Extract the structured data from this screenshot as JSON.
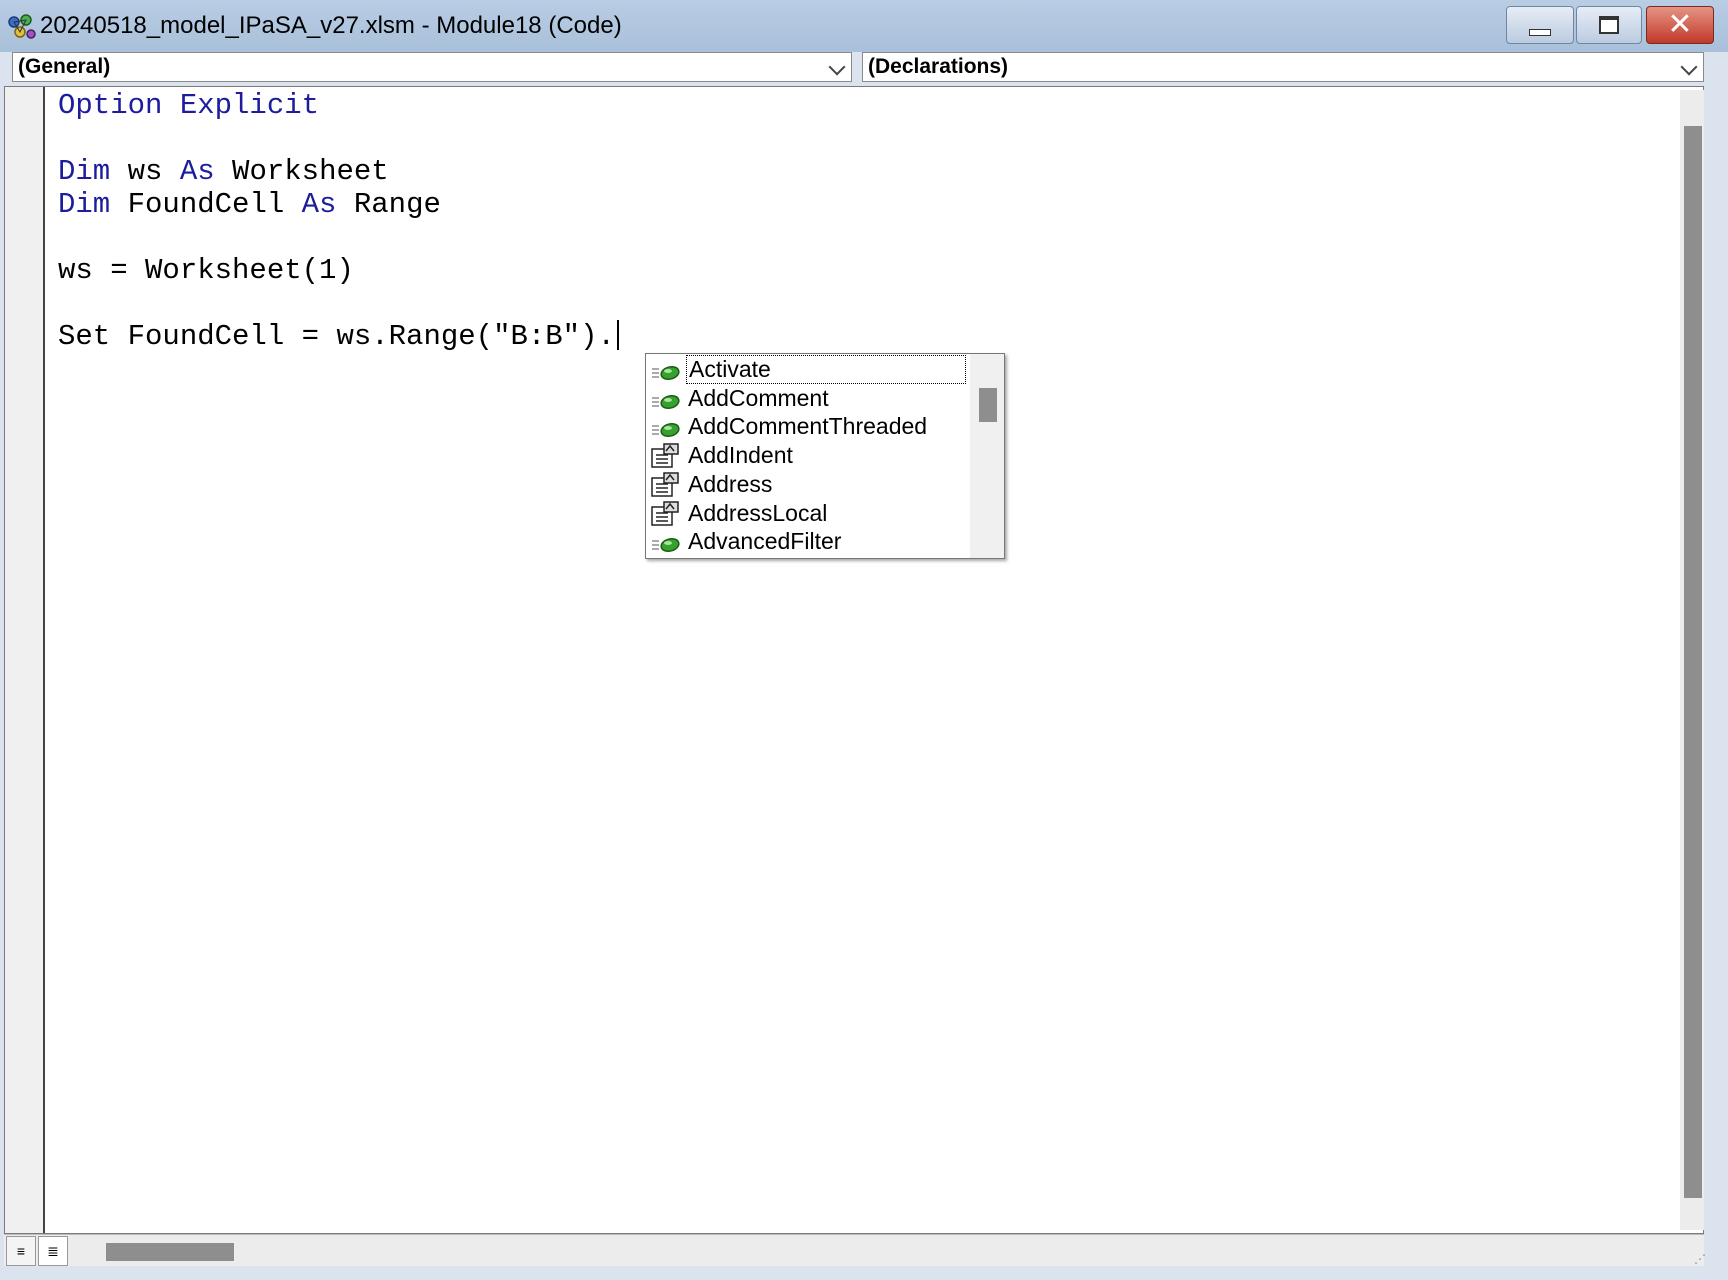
{
  "window": {
    "title": "20240518_model_IPaSA_v27.xlsm - Module18 (Code)"
  },
  "combos": {
    "object_value": "(General)",
    "procedure_value": "(Declarations)"
  },
  "code": {
    "lines": [
      [
        {
          "t": "Option Explicit",
          "k": true
        }
      ],
      [],
      [
        {
          "t": "Dim",
          "k": true
        },
        {
          "t": " ws ",
          "k": false
        },
        {
          "t": "As",
          "k": true
        },
        {
          "t": " Worksheet",
          "k": false
        }
      ],
      [
        {
          "t": "Dim",
          "k": true
        },
        {
          "t": " FoundCell ",
          "k": false
        },
        {
          "t": "As",
          "k": true
        },
        {
          "t": " Range",
          "k": false
        }
      ],
      [],
      [
        {
          "t": "ws = Worksheet(1)",
          "k": false
        }
      ],
      [],
      [
        {
          "t": "Set FoundCell = ws.Range(\"B:B\").",
          "k": false
        }
      ]
    ],
    "keyword_color": "#1c1c9c"
  },
  "intellisense": {
    "items": [
      {
        "label": "Activate",
        "kind": "method",
        "icon": "method-icon",
        "selected": true
      },
      {
        "label": "AddComment",
        "kind": "method",
        "icon": "method-icon",
        "selected": false
      },
      {
        "label": "AddCommentThreaded",
        "kind": "method",
        "icon": "method-icon",
        "selected": false
      },
      {
        "label": "AddIndent",
        "kind": "property",
        "icon": "property-icon",
        "selected": false
      },
      {
        "label": "Address",
        "kind": "property",
        "icon": "property-icon",
        "selected": false
      },
      {
        "label": "AddressLocal",
        "kind": "property",
        "icon": "property-icon",
        "selected": false
      },
      {
        "label": "AdvancedFilter",
        "kind": "method",
        "icon": "method-icon",
        "selected": false
      }
    ]
  },
  "bottom": {
    "procedure_view_icon": "procedure-view-icon",
    "full_module_view_icon": "full-module-view-icon"
  }
}
